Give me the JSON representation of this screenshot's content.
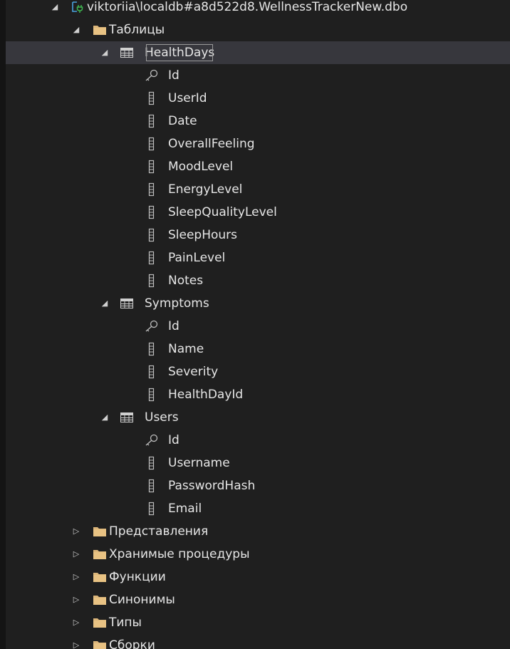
{
  "tree": {
    "root": {
      "label": "viktoriia\\localdb#a8d522d8.WellnessTrackerNew.dbo",
      "icon": "database-connection-icon",
      "expanded": true
    },
    "tables_folder": {
      "label": "Таблицы",
      "icon": "folder-icon",
      "expanded": true
    },
    "tables": [
      {
        "name": "HealthDays",
        "icon": "table-icon",
        "selected": true,
        "columns": [
          {
            "name": "Id",
            "icon": "key-icon"
          },
          {
            "name": "UserId",
            "icon": "column-icon"
          },
          {
            "name": "Date",
            "icon": "column-icon"
          },
          {
            "name": "OverallFeeling",
            "icon": "column-icon"
          },
          {
            "name": "MoodLevel",
            "icon": "column-icon"
          },
          {
            "name": "EnergyLevel",
            "icon": "column-icon"
          },
          {
            "name": "SleepQualityLevel",
            "icon": "column-icon"
          },
          {
            "name": "SleepHours",
            "icon": "column-icon"
          },
          {
            "name": "PainLevel",
            "icon": "column-icon"
          },
          {
            "name": "Notes",
            "icon": "column-icon"
          }
        ]
      },
      {
        "name": "Symptoms",
        "icon": "table-icon",
        "selected": false,
        "columns": [
          {
            "name": "Id",
            "icon": "key-icon"
          },
          {
            "name": "Name",
            "icon": "column-icon"
          },
          {
            "name": "Severity",
            "icon": "column-icon"
          },
          {
            "name": "HealthDayId",
            "icon": "column-icon"
          }
        ]
      },
      {
        "name": "Users",
        "icon": "table-icon",
        "selected": false,
        "columns": [
          {
            "name": "Id",
            "icon": "key-icon"
          },
          {
            "name": "Username",
            "icon": "column-icon"
          },
          {
            "name": "PasswordHash",
            "icon": "column-icon"
          },
          {
            "name": "Email",
            "icon": "column-icon"
          }
        ]
      }
    ],
    "folders": [
      {
        "label": "Представления",
        "icon": "folder-icon"
      },
      {
        "label": "Хранимые процедуры",
        "icon": "folder-icon"
      },
      {
        "label": "Функции",
        "icon": "folder-icon"
      },
      {
        "label": "Синонимы",
        "icon": "folder-icon"
      },
      {
        "label": "Типы",
        "icon": "folder-icon"
      },
      {
        "label": "Сборки",
        "icon": "folder-icon"
      }
    ]
  },
  "colors": {
    "background": "#1f1f1f",
    "selection": "#37373d",
    "folder": "#dcb67a",
    "text": "#e6e6e6",
    "connection_icon": "#4aa3df",
    "connection_plug": "#3fb950"
  }
}
